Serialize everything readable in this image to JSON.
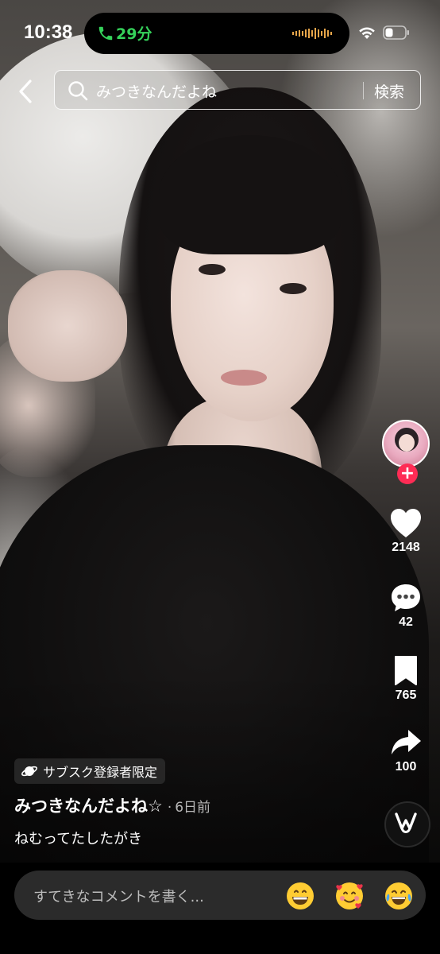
{
  "status_bar": {
    "time": "10:38",
    "call_duration": "29分",
    "call_color": "#35d15a",
    "wifi_icon": "wifi-icon",
    "battery_icon": "battery-icon"
  },
  "search": {
    "query": "みつきなんだよね",
    "button": "検索"
  },
  "video": {
    "subscriber_badge": "サブスク登録者限定",
    "author": "みつきなんだよね☆",
    "separator": "·",
    "posted": "6日前",
    "description": "ねむってたしたがき"
  },
  "actions": {
    "likes": "2148",
    "comments": "42",
    "saves": "765",
    "shares": "100",
    "follow_symbol": "+",
    "follow_color": "#fe2c55"
  },
  "comment_bar": {
    "placeholder": "すてきなコメントを書く...",
    "emojis": [
      "grinning-face-emoji",
      "smiling-face-with-hearts-emoji",
      "tears-of-joy-emoji"
    ]
  }
}
